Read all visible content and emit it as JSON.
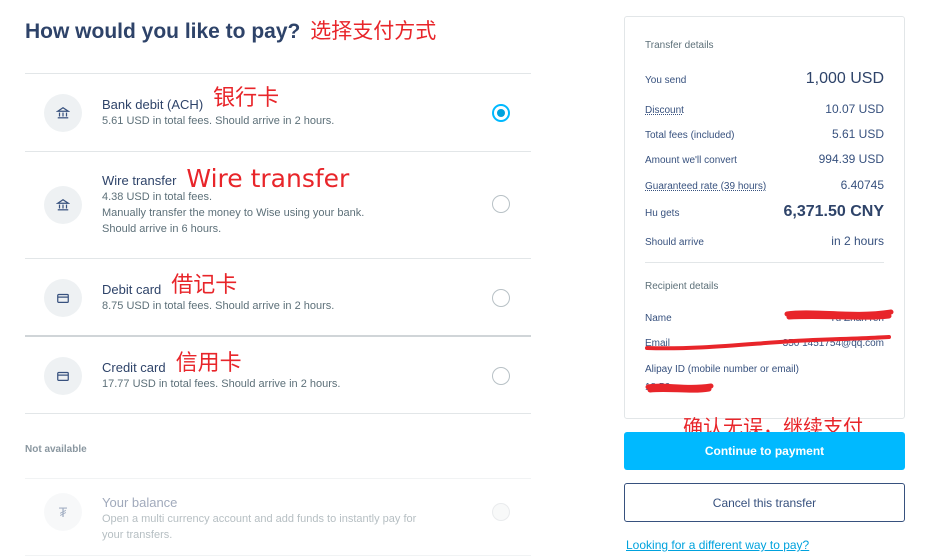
{
  "header": {
    "title": "How would you like to pay?",
    "annotation": "选择支付方式"
  },
  "methods": [
    {
      "name": "Bank debit (ACH)",
      "annotation": "银行卡",
      "desc": [
        "5.61 USD in total fees. Should arrive in 2 hours."
      ],
      "selected": true
    },
    {
      "name": "Wire transfer",
      "annotation": "Wire transfer",
      "desc": [
        "4.38 USD in total fees.",
        "Manually transfer the money to Wise using your bank.",
        "Should arrive in 6 hours."
      ],
      "selected": false
    },
    {
      "name": "Debit card",
      "annotation": "借记卡",
      "desc": [
        "8.75 USD in total fees. Should arrive in 2 hours."
      ],
      "selected": false
    },
    {
      "name": "Credit card",
      "annotation": "信用卡",
      "desc": [
        "17.77 USD in total fees. Should arrive in 2 hours."
      ],
      "selected": false
    }
  ],
  "not_available": {
    "label": "Not available",
    "name": "Your balance",
    "desc": [
      "Open a multi currency account and add funds to instantly pay for",
      "your transfers."
    ],
    "icon_glyph": "₮"
  },
  "transfer_details": {
    "title": "Transfer details",
    "rows": [
      {
        "label": "You send",
        "value": "1,000 USD"
      },
      {
        "label": "Discount",
        "value": "10.07 USD"
      },
      {
        "label": "Total fees (included)",
        "value": "5.61 USD"
      },
      {
        "label": "Amount we'll convert",
        "value": "994.39 USD"
      },
      {
        "label": "Guaranteed rate (39 hours)",
        "value": "6.40745"
      },
      {
        "label": "Hu gets",
        "value": "6,371.50 CNY"
      },
      {
        "label": "Should arrive",
        "value": "in 2 hours"
      }
    ]
  },
  "recipient_details": {
    "title": "Recipient details",
    "name_label": "Name",
    "name_visible": "Yu Zhan ren",
    "email_label": "Email",
    "email_visible": "350 1451754@qq.com",
    "alipay_label": "Alipay ID (mobile number or email)",
    "alipay_visible": "18 56"
  },
  "confirm_annotation": "确认无误，继续支付",
  "actions": {
    "continue": "Continue to payment",
    "cancel": "Cancel this transfer",
    "link": "Looking for a different way to pay?"
  },
  "colors": {
    "accent": "#00b9ff",
    "text": "#37517e",
    "annotation": "#e8252a"
  },
  "icons": [
    "bank-icon",
    "card-icon",
    "balance-icon",
    "radio-selected",
    "radio-empty"
  ]
}
